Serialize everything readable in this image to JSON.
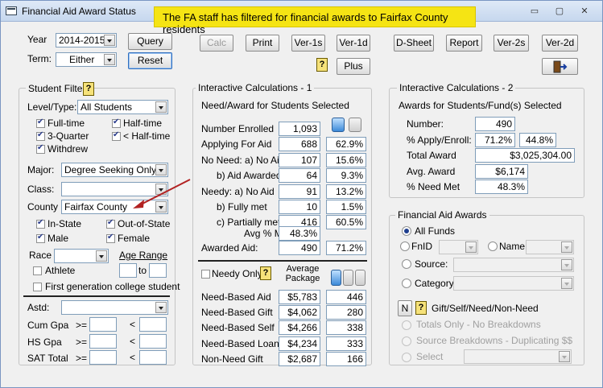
{
  "window": {
    "title": "Financial Aid Award Status",
    "banner": "The FA staff has filtered for financial awards to Fairfax County residents",
    "min": "▭",
    "max": "▢",
    "close": "✕"
  },
  "top": {
    "year_label": "Year",
    "year_value": "2014-2015",
    "term_label": "Term:",
    "term_value": "Either",
    "query": "Query",
    "reset": "Reset",
    "calc": "Calc",
    "print": "Print",
    "ver1s": "Ver-1s",
    "ver1d": "Ver-1d",
    "plus": "Plus",
    "dsheet": "D-Sheet",
    "report": "Report",
    "ver2s": "Ver-2s",
    "ver2d": "Ver-2d"
  },
  "filter": {
    "title": "Student Filter",
    "level_label": "Level/Type:",
    "level_value": "All Students",
    "fulltime": "Full-time",
    "halftime": "Half-time",
    "threequarter": "3-Quarter",
    "lthalf": "< Half-time",
    "withdrew": "Withdrew",
    "major_label": "Major:",
    "major_value": "Degree Seeking Only",
    "class_label": "Class:",
    "class_value": "",
    "county_label": "County",
    "county_value": "Fairfax County",
    "instate": "In-State",
    "outstate": "Out-of-State",
    "male": "Male",
    "female": "Female",
    "race_label": "Race",
    "race_value": "",
    "agerange_label": "Age Range",
    "athlete": "Athlete",
    "to": "to",
    "firstgen": "First generation college student",
    "astd_label": "Astd:",
    "cumgpa": "Cum Gpa",
    "hsgpa": "HS Gpa",
    "sattotal": "SAT Total",
    "ge": ">=",
    "lt": "<"
  },
  "calc1": {
    "title": "Interactive Calculations - 1",
    "subtitle": "Need/Award for Students Selected",
    "rows": [
      {
        "label": "Number Enrolled",
        "v1": "1,093",
        "v2": ""
      },
      {
        "label": "Applying For Aid",
        "v1": "688",
        "v2": "62.9%"
      },
      {
        "label": "No Need: a) No Aid",
        "v1": "107",
        "v2": "15.6%"
      },
      {
        "label": "b) Aid Awarded",
        "v1": "64",
        "v2": "9.3%"
      },
      {
        "label": "Needy:   a) No Aid",
        "v1": "91",
        "v2": "13.2%"
      },
      {
        "label": "b) Fully met",
        "v1": "10",
        "v2": "1.5%"
      },
      {
        "label": "c) Partially met",
        "v1": "416",
        "v2": "60.5%"
      }
    ],
    "avgmet_label": "Avg % Met",
    "avgmet_value": "48.3%",
    "awarded_label": "Awarded Aid:",
    "awarded_v1": "490",
    "awarded_v2": "71.2%",
    "needyonly": "Needy Only",
    "avgpkg": "Average Package",
    "pkg": [
      {
        "label": "Need-Based Aid",
        "v1": "$5,783",
        "v2": "446"
      },
      {
        "label": "Need-Based Gift",
        "v1": "$4,062",
        "v2": "280"
      },
      {
        "label": "Need-Based Self",
        "v1": "$4,266",
        "v2": "338"
      },
      {
        "label": "Need-Based Loan",
        "v1": "$4,234",
        "v2": "333"
      },
      {
        "label": "Non-Need Gift",
        "v1": "$2,687",
        "v2": "166"
      }
    ]
  },
  "calc2": {
    "title": "Interactive Calculations - 2",
    "subtitle": "Awards for Students/Fund(s) Selected",
    "number_label": "Number:",
    "number_value": "490",
    "apply_label": "% Apply/Enroll:",
    "apply_v1": "71.2%",
    "apply_v2": "44.8%",
    "total_label": "Total Award",
    "total_value": "$3,025,304.00",
    "avg_label": "Avg. Award",
    "avg_value": "$6,174",
    "needmet_label": "% Need Met",
    "needmet_value": "48.3%"
  },
  "fa": {
    "title": "Financial Aid Awards",
    "allfunds": "All Funds",
    "fnid": "FnID",
    "name": "Name",
    "source": "Source:",
    "category": "Category:",
    "n": "N",
    "gsnn": "Gift/Self/Need/Non-Need",
    "totalsonly": "Totals Only - No Breakdowns",
    "sourcebd": "Source Breakdowns - Duplicating $$",
    "select": "Select"
  },
  "colors": {
    "banner": "#f5e414",
    "annotation_arrow": "#b22222"
  }
}
